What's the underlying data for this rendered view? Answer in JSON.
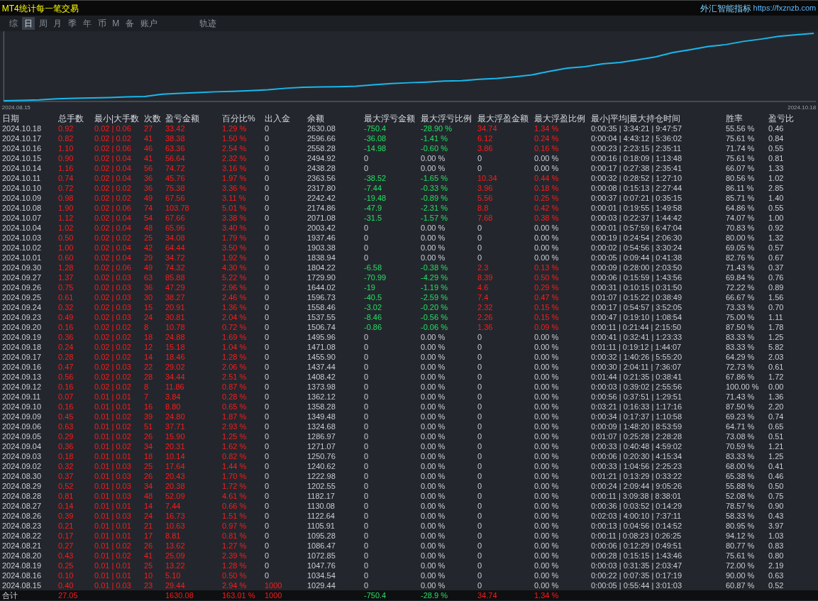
{
  "header": {
    "title": "MT4统计每一笔交易",
    "brand": "外汇智能指标",
    "url": "https://fxznzb.com"
  },
  "tabs": [
    {
      "label": "综",
      "selected": false
    },
    {
      "label": "日",
      "selected": true
    },
    {
      "label": "周",
      "selected": false
    },
    {
      "label": "月",
      "selected": false
    },
    {
      "label": "季",
      "selected": false
    },
    {
      "label": "年",
      "selected": false
    },
    {
      "label": "币",
      "selected": false
    },
    {
      "label": "M",
      "selected": false
    },
    {
      "label": "备",
      "selected": false
    },
    {
      "label": "账户",
      "selected": false
    },
    {
      "label": "轨迹",
      "selected": false
    }
  ],
  "equity_chart": {
    "start_label": "2024.08.15",
    "end_label": "2024.10.18"
  },
  "table": {
    "columns": [
      "日期",
      "总手数",
      "最小|大手数",
      "次数",
      "盈亏金额",
      "百分比%",
      "出入金",
      "余额",
      "最大浮亏金额",
      "最大浮亏比例",
      "最大浮盈金额",
      "最大浮盈比例",
      "最小|平均|最大持仓时间",
      "胜率",
      "盈亏比"
    ],
    "rows": [
      {
        "date": "2024.10.18",
        "lots": "0.92",
        "lot_range": "0.02 | 0.06",
        "trades": "27",
        "profit": "33.42",
        "percent": "1.29 %",
        "deposit": "0",
        "balance": "2630.08",
        "max_float_loss": "-750.4",
        "max_float_loss_pct": "-28.90 %",
        "max_float_profit": "34.74",
        "max_float_profit_pct": "1.34 %",
        "hold_times": "0:00:35 | 3:34:21 | 9:47:57",
        "win_rate": "55.56 %",
        "profit_factor": "0.46",
        "floating": true,
        "deposit_made": false
      },
      {
        "date": "2024.10.17",
        "lots": "0.82",
        "lot_range": "0.02 | 0.02",
        "trades": "41",
        "profit": "38.38",
        "percent": "1.50 %",
        "deposit": "0",
        "balance": "2596.66",
        "max_float_loss": "-36.08",
        "max_float_loss_pct": "-1.41 %",
        "max_float_profit": "6.12",
        "max_float_profit_pct": "0.24 %",
        "hold_times": "0:00:04 | 4:43:12 | 5:36:02",
        "win_rate": "75.61 %",
        "profit_factor": "0.84",
        "floating": true,
        "deposit_made": false
      },
      {
        "date": "2024.10.16",
        "lots": "1.10",
        "lot_range": "0.02 | 0.06",
        "trades": "46",
        "profit": "63.36",
        "percent": "2.54 %",
        "deposit": "0",
        "balance": "2558.28",
        "max_float_loss": "-14.98",
        "max_float_loss_pct": "-0.60 %",
        "max_float_profit": "3.86",
        "max_float_profit_pct": "0.16 %",
        "hold_times": "0:00:23 | 2:23:15 | 2:35:11",
        "win_rate": "71.74 %",
        "profit_factor": "0.55",
        "floating": true,
        "deposit_made": false
      },
      {
        "date": "2024.10.15",
        "lots": "0.90",
        "lot_range": "0.02 | 0.04",
        "trades": "41",
        "profit": "56.64",
        "percent": "2.32 %",
        "deposit": "0",
        "balance": "2494.92",
        "max_float_loss": "0",
        "max_float_loss_pct": "0.00 %",
        "max_float_profit": "0",
        "max_float_profit_pct": "0.00 %",
        "hold_times": "0:00:16 | 0:18:09 | 1:13:48",
        "win_rate": "75.61 %",
        "profit_factor": "0.81",
        "floating": false,
        "deposit_made": false
      },
      {
        "date": "2024.10.14",
        "lots": "1.16",
        "lot_range": "0.02 | 0.04",
        "trades": "56",
        "profit": "74.72",
        "percent": "3.16 %",
        "deposit": "0",
        "balance": "2438.28",
        "max_float_loss": "0",
        "max_float_loss_pct": "0.00 %",
        "max_float_profit": "0",
        "max_float_profit_pct": "0.00 %",
        "hold_times": "0:00:17 | 0:27:38 | 2:35:41",
        "win_rate": "66.07 %",
        "profit_factor": "1.33",
        "floating": false,
        "deposit_made": false
      },
      {
        "date": "2024.10.11",
        "lots": "0.74",
        "lot_range": "0.02 | 0.04",
        "trades": "36",
        "profit": "45.76",
        "percent": "1.97 %",
        "deposit": "0",
        "balance": "2363.56",
        "max_float_loss": "-38.52",
        "max_float_loss_pct": "-1.65 %",
        "max_float_profit": "10.34",
        "max_float_profit_pct": "0.44 %",
        "hold_times": "0:00:32 | 0:28:52 | 1:27:10",
        "win_rate": "80.56 %",
        "profit_factor": "1.02",
        "floating": true,
        "deposit_made": false
      },
      {
        "date": "2024.10.10",
        "lots": "0.72",
        "lot_range": "0.02 | 0.02",
        "trades": "36",
        "profit": "75.38",
        "percent": "3.36 %",
        "deposit": "0",
        "balance": "2317.80",
        "max_float_loss": "-7.44",
        "max_float_loss_pct": "-0.33 %",
        "max_float_profit": "3.96",
        "max_float_profit_pct": "0.18 %",
        "hold_times": "0:00:08 | 0:15:13 | 2:27:44",
        "win_rate": "86.11 %",
        "profit_factor": "2.85",
        "floating": true,
        "deposit_made": false
      },
      {
        "date": "2024.10.09",
        "lots": "0.98",
        "lot_range": "0.02 | 0.02",
        "trades": "49",
        "profit": "67.56",
        "percent": "3.11 %",
        "deposit": "0",
        "balance": "2242.42",
        "max_float_loss": "-19.48",
        "max_float_loss_pct": "-0.89 %",
        "max_float_profit": "5.56",
        "max_float_profit_pct": "0.25 %",
        "hold_times": "0:00:37 | 0:07:21 | 0:35:15",
        "win_rate": "85.71 %",
        "profit_factor": "1.40",
        "floating": true,
        "deposit_made": false
      },
      {
        "date": "2024.10.08",
        "lots": "1.90",
        "lot_range": "0.02 | 0.06",
        "trades": "74",
        "profit": "103.78",
        "percent": "5.01 %",
        "deposit": "0",
        "balance": "2174.86",
        "max_float_loss": "-47.9",
        "max_float_loss_pct": "-2.31 %",
        "max_float_profit": "8.8",
        "max_float_profit_pct": "0.42 %",
        "hold_times": "0:00:01 | 0:19:55 | 1:49:58",
        "win_rate": "64.86 %",
        "profit_factor": "0.55",
        "floating": true,
        "deposit_made": false
      },
      {
        "date": "2024.10.07",
        "lots": "1.12",
        "lot_range": "0.02 | 0.04",
        "trades": "54",
        "profit": "67.66",
        "percent": "3.38 %",
        "deposit": "0",
        "balance": "2071.08",
        "max_float_loss": "-31.5",
        "max_float_loss_pct": "-1.57 %",
        "max_float_profit": "7.68",
        "max_float_profit_pct": "0.38 %",
        "hold_times": "0:00:03 | 0:22:37 | 1:44:42",
        "win_rate": "74.07 %",
        "profit_factor": "1.00",
        "floating": true,
        "deposit_made": false
      },
      {
        "date": "2024.10.04",
        "lots": "1.02",
        "lot_range": "0.02 | 0.04",
        "trades": "48",
        "profit": "65.96",
        "percent": "3.40 %",
        "deposit": "0",
        "balance": "2003.42",
        "max_float_loss": "0",
        "max_float_loss_pct": "0.00 %",
        "max_float_profit": "0",
        "max_float_profit_pct": "0.00 %",
        "hold_times": "0:00:01 | 0:57:59 | 6:47:04",
        "win_rate": "70.83 %",
        "profit_factor": "0.92",
        "floating": false,
        "deposit_made": false
      },
      {
        "date": "2024.10.03",
        "lots": "0.50",
        "lot_range": "0.02 | 0.02",
        "trades": "25",
        "profit": "34.08",
        "percent": "1.79 %",
        "deposit": "0",
        "balance": "1937.46",
        "max_float_loss": "0",
        "max_float_loss_pct": "0.00 %",
        "max_float_profit": "0",
        "max_float_profit_pct": "0.00 %",
        "hold_times": "0:00:19 | 0:24:54 | 2:06:30",
        "win_rate": "80.00 %",
        "profit_factor": "1.32",
        "floating": false,
        "deposit_made": false
      },
      {
        "date": "2024.10.02",
        "lots": "1.00",
        "lot_range": "0.02 | 0.04",
        "trades": "42",
        "profit": "64.44",
        "percent": "3.50 %",
        "deposit": "0",
        "balance": "1903.38",
        "max_float_loss": "0",
        "max_float_loss_pct": "0.00 %",
        "max_float_profit": "0",
        "max_float_profit_pct": "0.00 %",
        "hold_times": "0:00:02 | 0:54:56 | 3:30:24",
        "win_rate": "69.05 %",
        "profit_factor": "0.57",
        "floating": false,
        "deposit_made": false
      },
      {
        "date": "2024.10.01",
        "lots": "0.60",
        "lot_range": "0.02 | 0.04",
        "trades": "29",
        "profit": "34.72",
        "percent": "1.92 %",
        "deposit": "0",
        "balance": "1838.94",
        "max_float_loss": "0",
        "max_float_loss_pct": "0.00 %",
        "max_float_profit": "0",
        "max_float_profit_pct": "0.00 %",
        "hold_times": "0:00:05 | 0:09:44 | 0:41:38",
        "win_rate": "82.76 %",
        "profit_factor": "0.67",
        "floating": false,
        "deposit_made": false
      },
      {
        "date": "2024.09.30",
        "lots": "1.28",
        "lot_range": "0.02 | 0.06",
        "trades": "49",
        "profit": "74.32",
        "percent": "4.30 %",
        "deposit": "0",
        "balance": "1804.22",
        "max_float_loss": "-6.58",
        "max_float_loss_pct": "-0.38 %",
        "max_float_profit": "2.3",
        "max_float_profit_pct": "0.13 %",
        "hold_times": "0:00:09 | 0:28:00 | 2:03:50",
        "win_rate": "71.43 %",
        "profit_factor": "0.37",
        "floating": true,
        "deposit_made": false
      },
      {
        "date": "2024.09.27",
        "lots": "1.37",
        "lot_range": "0.02 | 0.03",
        "trades": "63",
        "profit": "85.88",
        "percent": "5.22 %",
        "deposit": "0",
        "balance": "1729.90",
        "max_float_loss": "-70.99",
        "max_float_loss_pct": "-4.29 %",
        "max_float_profit": "8.39",
        "max_float_profit_pct": "0.50 %",
        "hold_times": "0:00:06 | 0:15:59 | 1:43:56",
        "win_rate": "69.84 %",
        "profit_factor": "0.76",
        "floating": true,
        "deposit_made": false
      },
      {
        "date": "2024.09.26",
        "lots": "0.75",
        "lot_range": "0.02 | 0.03",
        "trades": "36",
        "profit": "47.29",
        "percent": "2.96 %",
        "deposit": "0",
        "balance": "1644.02",
        "max_float_loss": "-19",
        "max_float_loss_pct": "-1.19 %",
        "max_float_profit": "4.6",
        "max_float_profit_pct": "0.29 %",
        "hold_times": "0:00:31 | 0:10:15 | 0:31:50",
        "win_rate": "72.22 %",
        "profit_factor": "0.89",
        "floating": true,
        "deposit_made": false
      },
      {
        "date": "2024.09.25",
        "lots": "0.61",
        "lot_range": "0.02 | 0.03",
        "trades": "30",
        "profit": "38.27",
        "percent": "2.46 %",
        "deposit": "0",
        "balance": "1596.73",
        "max_float_loss": "-40.5",
        "max_float_loss_pct": "-2.59 %",
        "max_float_profit": "7.4",
        "max_float_profit_pct": "0.47 %",
        "hold_times": "0:01:07 | 0:15:22 | 0:38:49",
        "win_rate": "66.67 %",
        "profit_factor": "1.56",
        "floating": true,
        "deposit_made": false
      },
      {
        "date": "2024.09.24",
        "lots": "0.32",
        "lot_range": "0.02 | 0.03",
        "trades": "15",
        "profit": "20.91",
        "percent": "1.36 %",
        "deposit": "0",
        "balance": "1558.46",
        "max_float_loss": "-3.02",
        "max_float_loss_pct": "-0.20 %",
        "max_float_profit": "2.32",
        "max_float_profit_pct": "0.15 %",
        "hold_times": "0:00:17 | 0:54:57 | 3:52:05",
        "win_rate": "73.33 %",
        "profit_factor": "0.70",
        "floating": true,
        "deposit_made": false
      },
      {
        "date": "2024.09.23",
        "lots": "0.49",
        "lot_range": "0.02 | 0.03",
        "trades": "24",
        "profit": "30.81",
        "percent": "2.04 %",
        "deposit": "0",
        "balance": "1537.55",
        "max_float_loss": "-8.46",
        "max_float_loss_pct": "-0.56 %",
        "max_float_profit": "2.26",
        "max_float_profit_pct": "0.15 %",
        "hold_times": "0:00:47 | 0:19:10 | 1:08:54",
        "win_rate": "75.00 %",
        "profit_factor": "1.11",
        "floating": true,
        "deposit_made": false
      },
      {
        "date": "2024.09.20",
        "lots": "0.16",
        "lot_range": "0.02 | 0.02",
        "trades": "8",
        "profit": "10.78",
        "percent": "0.72 %",
        "deposit": "0",
        "balance": "1506.74",
        "max_float_loss": "-0.86",
        "max_float_loss_pct": "-0.06 %",
        "max_float_profit": "1.36",
        "max_float_profit_pct": "0.09 %",
        "hold_times": "0:00:11 | 0:21:44 | 2:15:50",
        "win_rate": "87.50 %",
        "profit_factor": "1.78",
        "floating": true,
        "deposit_made": false
      },
      {
        "date": "2024.09.19",
        "lots": "0.36",
        "lot_range": "0.02 | 0.02",
        "trades": "18",
        "profit": "24.88",
        "percent": "1.69 %",
        "deposit": "0",
        "balance": "1495.96",
        "max_float_loss": "0",
        "max_float_loss_pct": "0.00 %",
        "max_float_profit": "0",
        "max_float_profit_pct": "0.00 %",
        "hold_times": "0:00:41 | 0:32:41 | 1:23:33",
        "win_rate": "83.33 %",
        "profit_factor": "1.25",
        "floating": false,
        "deposit_made": false
      },
      {
        "date": "2024.09.18",
        "lots": "0.24",
        "lot_range": "0.02 | 0.02",
        "trades": "12",
        "profit": "15.18",
        "percent": "1.04 %",
        "deposit": "0",
        "balance": "1471.08",
        "max_float_loss": "0",
        "max_float_loss_pct": "0.00 %",
        "max_float_profit": "0",
        "max_float_profit_pct": "0.00 %",
        "hold_times": "0:01:11 | 0:19:12 | 1:44:07",
        "win_rate": "83.33 %",
        "profit_factor": "5.82",
        "floating": false,
        "deposit_made": false
      },
      {
        "date": "2024.09.17",
        "lots": "0.28",
        "lot_range": "0.02 | 0.02",
        "trades": "14",
        "profit": "18.46",
        "percent": "1.28 %",
        "deposit": "0",
        "balance": "1455.90",
        "max_float_loss": "0",
        "max_float_loss_pct": "0.00 %",
        "max_float_profit": "0",
        "max_float_profit_pct": "0.00 %",
        "hold_times": "0:00:32 | 1:40:26 | 5:55:20",
        "win_rate": "64.29 %",
        "profit_factor": "2.03",
        "floating": false,
        "deposit_made": false
      },
      {
        "date": "2024.09.16",
        "lots": "0.47",
        "lot_range": "0.02 | 0.03",
        "trades": "22",
        "profit": "29.02",
        "percent": "2.06 %",
        "deposit": "0",
        "balance": "1437.44",
        "max_float_loss": "0",
        "max_float_loss_pct": "0.00 %",
        "max_float_profit": "0",
        "max_float_profit_pct": "0.00 %",
        "hold_times": "0:00:30 | 2:04:11 | 7:36:07",
        "win_rate": "72.73 %",
        "profit_factor": "0.61",
        "floating": false,
        "deposit_made": false
      },
      {
        "date": "2024.09.13",
        "lots": "0.56",
        "lot_range": "0.02 | 0.02",
        "trades": "28",
        "profit": "34.44",
        "percent": "2.51 %",
        "deposit": "0",
        "balance": "1408.42",
        "max_float_loss": "0",
        "max_float_loss_pct": "0.00 %",
        "max_float_profit": "0",
        "max_float_profit_pct": "0.00 %",
        "hold_times": "0:01:44 | 0:21:35 | 0:38:41",
        "win_rate": "67.86 %",
        "profit_factor": "1.72",
        "floating": false,
        "deposit_made": false
      },
      {
        "date": "2024.09.12",
        "lots": "0.16",
        "lot_range": "0.02 | 0.02",
        "trades": "8",
        "profit": "11.86",
        "percent": "0.87 %",
        "deposit": "0",
        "balance": "1373.98",
        "max_float_loss": "0",
        "max_float_loss_pct": "0.00 %",
        "max_float_profit": "0",
        "max_float_profit_pct": "0.00 %",
        "hold_times": "0:00:03 | 0:39:02 | 2:55:56",
        "win_rate": "100.00 %",
        "profit_factor": "0.00",
        "floating": false,
        "deposit_made": false
      },
      {
        "date": "2024.09.11",
        "lots": "0.07",
        "lot_range": "0.01 | 0.01",
        "trades": "7",
        "profit": "3.84",
        "percent": "0.28 %",
        "deposit": "0",
        "balance": "1362.12",
        "max_float_loss": "0",
        "max_float_loss_pct": "0.00 %",
        "max_float_profit": "0",
        "max_float_profit_pct": "0.00 %",
        "hold_times": "0:00:56 | 0:37:51 | 1:29:51",
        "win_rate": "71.43 %",
        "profit_factor": "1.36",
        "floating": false,
        "deposit_made": false
      },
      {
        "date": "2024.09.10",
        "lots": "0.16",
        "lot_range": "0.01 | 0.01",
        "trades": "16",
        "profit": "8.80",
        "percent": "0.65 %",
        "deposit": "0",
        "balance": "1358.28",
        "max_float_loss": "0",
        "max_float_loss_pct": "0.00 %",
        "max_float_profit": "0",
        "max_float_profit_pct": "0.00 %",
        "hold_times": "0:03:21 | 0:16:33 | 1:17:16",
        "win_rate": "87.50 %",
        "profit_factor": "2.20",
        "floating": false,
        "deposit_made": false
      },
      {
        "date": "2024.09.09",
        "lots": "0.45",
        "lot_range": "0.01 | 0.02",
        "trades": "39",
        "profit": "24.80",
        "percent": "1.87 %",
        "deposit": "0",
        "balance": "1349.48",
        "max_float_loss": "0",
        "max_float_loss_pct": "0.00 %",
        "max_float_profit": "0",
        "max_float_profit_pct": "0.00 %",
        "hold_times": "0:00:34 | 0:17:37 | 1:10:58",
        "win_rate": "69.23 %",
        "profit_factor": "0.74",
        "floating": false,
        "deposit_made": false
      },
      {
        "date": "2024.09.06",
        "lots": "0.63",
        "lot_range": "0.01 | 0.02",
        "trades": "51",
        "profit": "37.71",
        "percent": "2.93 %",
        "deposit": "0",
        "balance": "1324.68",
        "max_float_loss": "0",
        "max_float_loss_pct": "0.00 %",
        "max_float_profit": "0",
        "max_float_profit_pct": "0.00 %",
        "hold_times": "0:00:09 | 1:48:20 | 8:53:59",
        "win_rate": "64.71 %",
        "profit_factor": "0.65",
        "floating": false,
        "deposit_made": false
      },
      {
        "date": "2024.09.05",
        "lots": "0.29",
        "lot_range": "0.01 | 0.02",
        "trades": "26",
        "profit": "15.90",
        "percent": "1.25 %",
        "deposit": "0",
        "balance": "1286.97",
        "max_float_loss": "0",
        "max_float_loss_pct": "0.00 %",
        "max_float_profit": "0",
        "max_float_profit_pct": "0.00 %",
        "hold_times": "0:01:07 | 0:25:28 | 2:28:28",
        "win_rate": "73.08 %",
        "profit_factor": "0.51",
        "floating": false,
        "deposit_made": false
      },
      {
        "date": "2024.09.04",
        "lots": "0.36",
        "lot_range": "0.01 | 0.02",
        "trades": "34",
        "profit": "20.31",
        "percent": "1.62 %",
        "deposit": "0",
        "balance": "1271.07",
        "max_float_loss": "0",
        "max_float_loss_pct": "0.00 %",
        "max_float_profit": "0",
        "max_float_profit_pct": "0.00 %",
        "hold_times": "0:00:33 | 0:40:48 | 4:59:02",
        "win_rate": "70.59 %",
        "profit_factor": "1.21",
        "floating": false,
        "deposit_made": false
      },
      {
        "date": "2024.09.03",
        "lots": "0.18",
        "lot_range": "0.01 | 0.01",
        "trades": "18",
        "profit": "10.14",
        "percent": "0.82 %",
        "deposit": "0",
        "balance": "1250.76",
        "max_float_loss": "0",
        "max_float_loss_pct": "0.00 %",
        "max_float_profit": "0",
        "max_float_profit_pct": "0.00 %",
        "hold_times": "0:00:06 | 0:20:30 | 4:15:34",
        "win_rate": "83.33 %",
        "profit_factor": "1.25",
        "floating": false,
        "deposit_made": false
      },
      {
        "date": "2024.09.02",
        "lots": "0.32",
        "lot_range": "0.01 | 0.03",
        "trades": "25",
        "profit": "17.64",
        "percent": "1.44 %",
        "deposit": "0",
        "balance": "1240.62",
        "max_float_loss": "0",
        "max_float_loss_pct": "0.00 %",
        "max_float_profit": "0",
        "max_float_profit_pct": "0.00 %",
        "hold_times": "0:00:33 | 1:04:56 | 2:25:23",
        "win_rate": "68.00 %",
        "profit_factor": "0.41",
        "floating": false,
        "deposit_made": false
      },
      {
        "date": "2024.08.30",
        "lots": "0.37",
        "lot_range": "0.01 | 0.03",
        "trades": "26",
        "profit": "20.43",
        "percent": "1.70 %",
        "deposit": "0",
        "balance": "1222.98",
        "max_float_loss": "0",
        "max_float_loss_pct": "0.00 %",
        "max_float_profit": "0",
        "max_float_profit_pct": "0.00 %",
        "hold_times": "0:01:21 | 0:13:29 | 0:33:22",
        "win_rate": "65.38 %",
        "profit_factor": "0.46",
        "floating": false,
        "deposit_made": false
      },
      {
        "date": "2024.08.29",
        "lots": "0.52",
        "lot_range": "0.01 | 0.03",
        "trades": "34",
        "profit": "20.38",
        "percent": "1.72 %",
        "deposit": "0",
        "balance": "1202.55",
        "max_float_loss": "0",
        "max_float_loss_pct": "0.00 %",
        "max_float_profit": "0",
        "max_float_profit_pct": "0.00 %",
        "hold_times": "0:00:24 | 2:09:44 | 9:05:26",
        "win_rate": "55.88 %",
        "profit_factor": "0.50",
        "floating": false,
        "deposit_made": false
      },
      {
        "date": "2024.08.28",
        "lots": "0.81",
        "lot_range": "0.01 | 0.03",
        "trades": "48",
        "profit": "52.09",
        "percent": "4.61 %",
        "deposit": "0",
        "balance": "1182.17",
        "max_float_loss": "0",
        "max_float_loss_pct": "0.00 %",
        "max_float_profit": "0",
        "max_float_profit_pct": "0.00 %",
        "hold_times": "0:00:11 | 3:09:38 | 8:38:01",
        "win_rate": "52.08 %",
        "profit_factor": "0.75",
        "floating": false,
        "deposit_made": false
      },
      {
        "date": "2024.08.27",
        "lots": "0.14",
        "lot_range": "0.01 | 0.01",
        "trades": "14",
        "profit": "7.44",
        "percent": "0.66 %",
        "deposit": "0",
        "balance": "1130.08",
        "max_float_loss": "0",
        "max_float_loss_pct": "0.00 %",
        "max_float_profit": "0",
        "max_float_profit_pct": "0.00 %",
        "hold_times": "0:00:36 | 0:03:52 | 0:14:29",
        "win_rate": "78.57 %",
        "profit_factor": "0.90",
        "floating": false,
        "deposit_made": false
      },
      {
        "date": "2024.08.26",
        "lots": "0.39",
        "lot_range": "0.01 | 0.03",
        "trades": "24",
        "profit": "16.73",
        "percent": "1.51 %",
        "deposit": "0",
        "balance": "1122.64",
        "max_float_loss": "0",
        "max_float_loss_pct": "0.00 %",
        "max_float_profit": "0",
        "max_float_profit_pct": "0.00 %",
        "hold_times": "0:02:03 | 4:00:10 | 7:37:11",
        "win_rate": "58.33 %",
        "profit_factor": "0.43",
        "floating": false,
        "deposit_made": false
      },
      {
        "date": "2024.08.23",
        "lots": "0.21",
        "lot_range": "0.01 | 0.01",
        "trades": "21",
        "profit": "10.63",
        "percent": "0.97 %",
        "deposit": "0",
        "balance": "1105.91",
        "max_float_loss": "0",
        "max_float_loss_pct": "0.00 %",
        "max_float_profit": "0",
        "max_float_profit_pct": "0.00 %",
        "hold_times": "0:00:13 | 0:04:56 | 0:14:52",
        "win_rate": "80.95 %",
        "profit_factor": "3.97",
        "floating": false,
        "deposit_made": false
      },
      {
        "date": "2024.08.22",
        "lots": "0.17",
        "lot_range": "0.01 | 0.01",
        "trades": "17",
        "profit": "8.81",
        "percent": "0.81 %",
        "deposit": "0",
        "balance": "1095.28",
        "max_float_loss": "0",
        "max_float_loss_pct": "0.00 %",
        "max_float_profit": "0",
        "max_float_profit_pct": "0.00 %",
        "hold_times": "0:00:11 | 0:08:23 | 0:26:25",
        "win_rate": "94.12 %",
        "profit_factor": "1.03",
        "floating": false,
        "deposit_made": false
      },
      {
        "date": "2024.08.21",
        "lots": "0.27",
        "lot_range": "0.01 | 0.02",
        "trades": "26",
        "profit": "13.62",
        "percent": "1.27 %",
        "deposit": "0",
        "balance": "1086.47",
        "max_float_loss": "0",
        "max_float_loss_pct": "0.00 %",
        "max_float_profit": "0",
        "max_float_profit_pct": "0.00 %",
        "hold_times": "0:00:06 | 0:12:29 | 0:49:51",
        "win_rate": "80.77 %",
        "profit_factor": "0.83",
        "floating": false,
        "deposit_made": false
      },
      {
        "date": "2024.08.20",
        "lots": "0.43",
        "lot_range": "0.01 | 0.02",
        "trades": "41",
        "profit": "25.09",
        "percent": "2.39 %",
        "deposit": "0",
        "balance": "1072.85",
        "max_float_loss": "0",
        "max_float_loss_pct": "0.00 %",
        "max_float_profit": "0",
        "max_float_profit_pct": "0.00 %",
        "hold_times": "0:00:28 | 0:15:15 | 1:43:46",
        "win_rate": "75.61 %",
        "profit_factor": "0.80",
        "floating": false,
        "deposit_made": false
      },
      {
        "date": "2024.08.19",
        "lots": "0.25",
        "lot_range": "0.01 | 0.01",
        "trades": "25",
        "profit": "13.22",
        "percent": "1.28 %",
        "deposit": "0",
        "balance": "1047.76",
        "max_float_loss": "0",
        "max_float_loss_pct": "0.00 %",
        "max_float_profit": "0",
        "max_float_profit_pct": "0.00 %",
        "hold_times": "0:00:03 | 0:31:35 | 2:03:47",
        "win_rate": "72.00 %",
        "profit_factor": "2.19",
        "floating": false,
        "deposit_made": false
      },
      {
        "date": "2024.08.16",
        "lots": "0.10",
        "lot_range": "0.01 | 0.01",
        "trades": "10",
        "profit": "5.10",
        "percent": "0.50 %",
        "deposit": "0",
        "balance": "1034.54",
        "max_float_loss": "0",
        "max_float_loss_pct": "0.00 %",
        "max_float_profit": "0",
        "max_float_profit_pct": "0.00 %",
        "hold_times": "0:00:22 | 0:07:35 | 0:17:19",
        "win_rate": "90.00 %",
        "profit_factor": "0.63",
        "floating": false,
        "deposit_made": false
      },
      {
        "date": "2024.08.15",
        "lots": "0.40",
        "lot_range": "0.01 | 0.03",
        "trades": "23",
        "profit": "29.44",
        "percent": "2.94 %",
        "deposit": "1000",
        "balance": "1029.44",
        "max_float_loss": "0",
        "max_float_loss_pct": "0.00 %",
        "max_float_profit": "0",
        "max_float_profit_pct": "0.00 %",
        "hold_times": "0:00:05 | 0:55:44 | 3:01:03",
        "win_rate": "60.87 %",
        "profit_factor": "0.52",
        "floating": false,
        "deposit_made": true
      }
    ],
    "totals": {
      "date": "合计",
      "lots": "27.05",
      "profit": "1630.08",
      "percent": "163.01 %",
      "deposit": "1000",
      "max_float_loss": "-750.4",
      "max_float_loss_pct": "-28.9 %",
      "max_float_profit": "34.74",
      "max_float_profit_pct": "1.34 %"
    }
  }
}
